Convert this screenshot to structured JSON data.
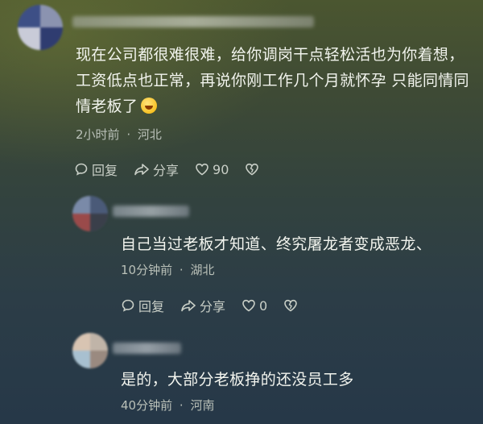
{
  "comments": [
    {
      "text": "现在公司都很难很难，给你调岗干点轻松活也为你着想，工资低点也正常，再说你刚工作几个月就怀孕 只能同情同情老板了",
      "emoji": "laughing-emoji",
      "time": "2小时前",
      "location": "河北",
      "reply_label": "回复",
      "share_label": "分享",
      "like_count": "90"
    },
    {
      "text": "自己当过老板才知道、终究屠龙者变成恶龙、",
      "time": "10分钟前",
      "location": "湖北",
      "reply_label": "回复",
      "share_label": "分享",
      "like_count": "0"
    },
    {
      "text": "是的，大部分老板挣的还没员工多",
      "time": "40分钟前",
      "location": "河南"
    }
  ],
  "separator": "·"
}
